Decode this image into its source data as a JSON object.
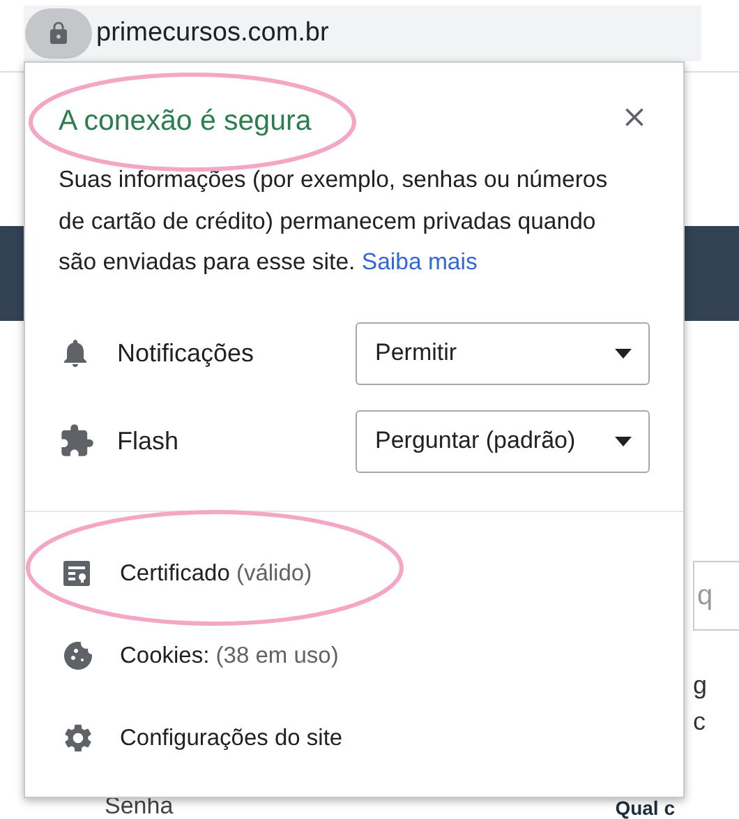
{
  "address_bar": {
    "url": "primecursos.com.br"
  },
  "page": {
    "field_fragment": "q",
    "text_fragments": [
      "g",
      "c"
    ],
    "label": "Senha",
    "heading": "Qual c"
  },
  "popup": {
    "title": "A conexão é segura",
    "description": "Suas informações (por exemplo, senhas ou números de cartão de crédito) permanecem privadas quando são enviadas para esse site.",
    "link": "Saiba mais",
    "permissions": [
      {
        "kind": "notifications",
        "label": "Notificações",
        "value": "Permitir"
      },
      {
        "kind": "flash",
        "label": "Flash",
        "value": "Perguntar (padrão)"
      }
    ],
    "items": [
      {
        "kind": "certificate",
        "label": "Certificado",
        "detail": "(válido)"
      },
      {
        "kind": "cookies",
        "label": "Cookies:",
        "detail": "(38 em uso)"
      },
      {
        "kind": "settings",
        "label": "Configurações do site"
      }
    ]
  }
}
